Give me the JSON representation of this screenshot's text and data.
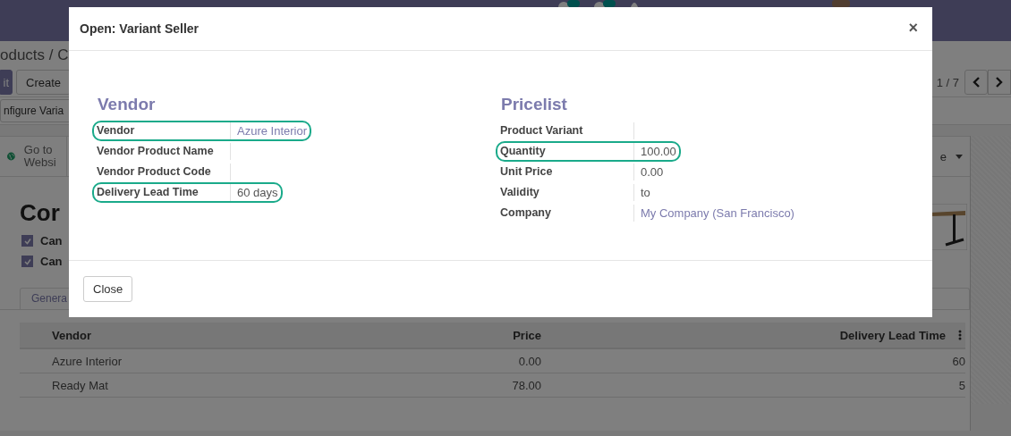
{
  "breadcrumb": "oducts / C",
  "buttons": [
    "it",
    "Create"
  ],
  "pager": "1 / 7",
  "status_button": "nfigure Varia",
  "stat_button": "Go to Websi",
  "dropdown": "e",
  "product_title": "Cor",
  "options": [
    {
      "label": "Can",
      "checked": true
    },
    {
      "label": "Can",
      "checked": true
    }
  ],
  "tabs": [
    {
      "label": "Genera",
      "selected": false
    }
  ],
  "table": {
    "columns": [
      "Vendor",
      "Price",
      "Delivery Lead Time"
    ],
    "rows": [
      [
        "Azure Interior",
        "0.00",
        "60"
      ],
      [
        "Ready Mat",
        "78.00",
        "5"
      ]
    ]
  },
  "dialog": {
    "title": "Open: Variant Seller",
    "close": "×",
    "groups": [
      {
        "title": "Vendor",
        "fields": [
          {
            "label": "Vendor",
            "value": "Azure Interior",
            "kind": "link",
            "highlighted": true
          },
          {
            "label": "Vendor Product Name",
            "kind": "empty",
            "highlighted": false
          },
          {
            "label": "Vendor Product Code",
            "kind": "empty",
            "highlighted": false
          },
          {
            "label": "Delivery Lead Time",
            "value": "60 days",
            "kind": "text",
            "highlighted": true
          }
        ]
      },
      {
        "title": "Pricelist",
        "fields": [
          {
            "label": "Product Variant",
            "kind": "empty",
            "highlighted": false
          },
          {
            "label": "Quantity",
            "value": "100.00",
            "kind": "text",
            "highlighted": true
          },
          {
            "label": "Unit Price",
            "value": "0.00",
            "kind": "text",
            "highlighted": false
          },
          {
            "label": "Validity",
            "value": "to",
            "kind": "text",
            "highlighted": false
          },
          {
            "label": "Company",
            "value": "My Company (San Francisco)",
            "kind": "link",
            "highlighted": false
          }
        ]
      }
    ],
    "footer_button": "Close"
  }
}
